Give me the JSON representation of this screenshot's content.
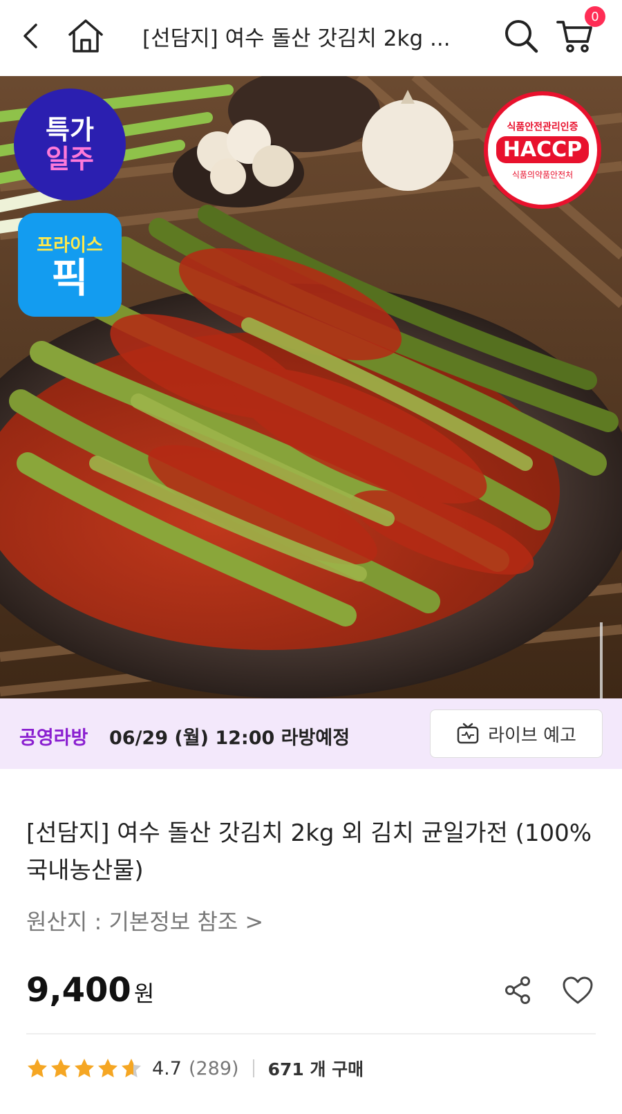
{
  "header": {
    "title": "[선담지] 여수 돌산 갓김치 2kg ...",
    "cart_count": "0"
  },
  "badges": {
    "special_line1": "특가",
    "special_line2": "일주",
    "price_line1": "프라이스",
    "price_line2": "픽",
    "haccp_top": "식품안전관리인증",
    "haccp_main": "HACCP",
    "haccp_bottom": "식품의약품안전처"
  },
  "live": {
    "tag": "공영라방",
    "schedule": "06/29 (월) 12:00 라방예정",
    "button_label": "라이브 예고"
  },
  "product": {
    "title": "[선담지] 여수 돌산 갓김치 2kg 외 김치 균일가전 (100% 국내농산물)",
    "origin": "원산지 : 기본정보 참조 >",
    "price": "9,400",
    "price_unit": "원",
    "rating": "4.7",
    "review_count": "(289)",
    "purchase_count": "671 개 구매",
    "rating_value": 4.7
  },
  "icons": {
    "back": "back-arrow-icon",
    "home": "home-icon",
    "search": "search-icon",
    "cart": "cart-icon",
    "share": "share-icon",
    "like": "heart-icon",
    "live_tv": "tv-icon",
    "star": "star-icon"
  },
  "colors": {
    "accent_purple": "#8a1fd0",
    "banner_bg": "#f3e8fb",
    "badge_red": "#ff2d55",
    "star": "#f5a623"
  }
}
